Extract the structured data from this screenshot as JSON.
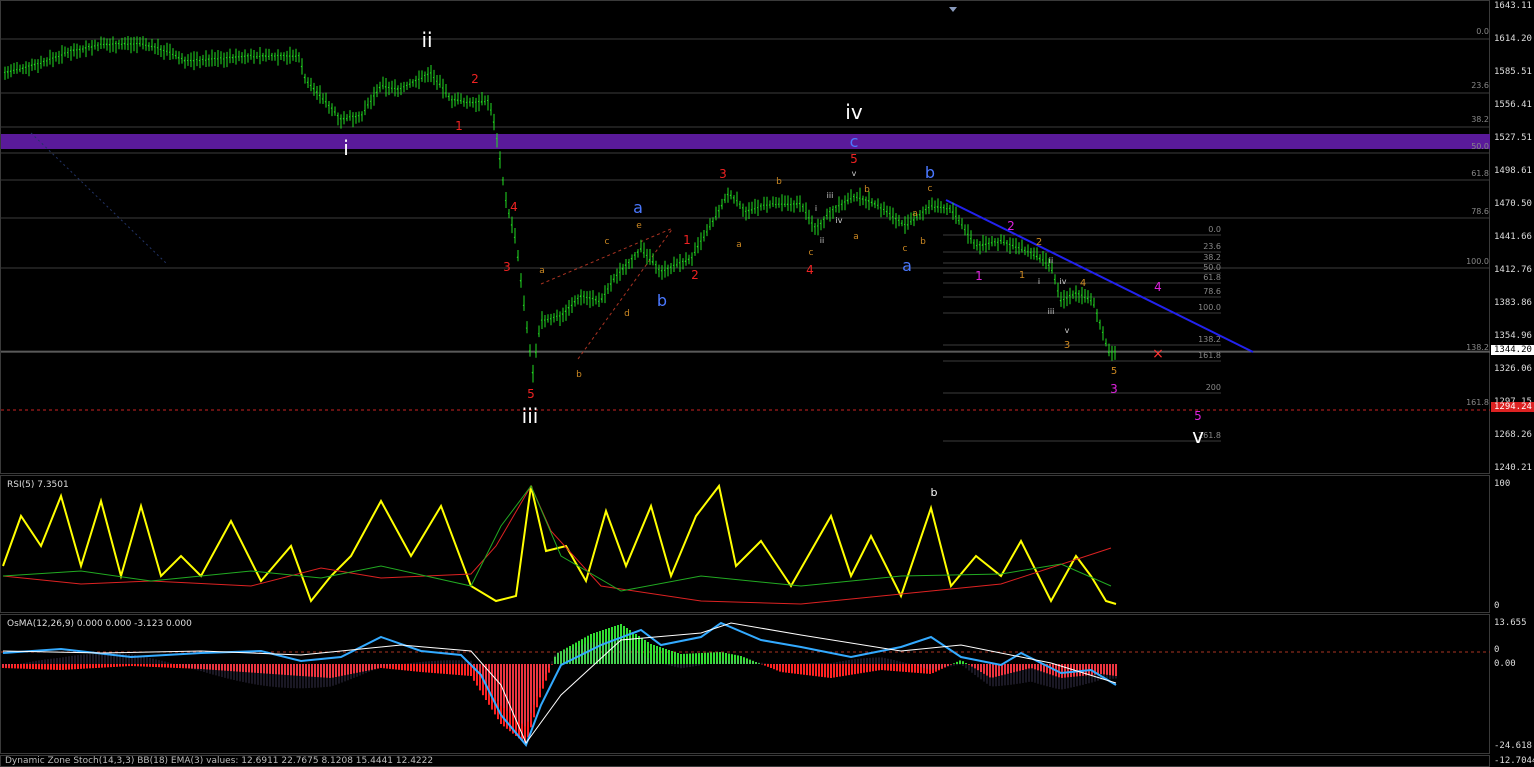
{
  "colors": {
    "background": "#000000",
    "candle": "#22dd22",
    "zone": "#5a1a9a",
    "grid": "#3c3c3c",
    "trendline": "#2222ee",
    "support": "#cc2222",
    "rsi": "#ffff00",
    "rsi_ma_green": "#22aa22",
    "rsi_ma_red": "#dd2222",
    "osma_green": "#33dd33",
    "osma_red": "#ff2222",
    "osma_line": "#33aaff"
  },
  "main_axis": {
    "ticks": [
      "1643.11",
      "1614.20",
      "1585.51",
      "1556.41",
      "1527.51",
      "1498.61",
      "1470.50",
      "1441.66",
      "1412.76",
      "1383.86",
      "1354.96",
      "1326.06",
      "1297.15",
      "1268.26",
      "1240.21"
    ]
  },
  "current_price": "1344.20",
  "support_price": "1294.24",
  "rsi": {
    "label": "RSI(5) 7.3501",
    "ticks": [
      "100",
      "0"
    ]
  },
  "osma": {
    "label": "OsMA(12,26,9) 0.000 0.000 -3.123 0.000",
    "ticks": [
      "13.655",
      "0",
      "0.00",
      "-24.618"
    ]
  },
  "stoch": {
    "label": "Dynamic Zone Stoch(14,3,3) BB(18) EMA(3) values: 12.6911 22.7675 8.1208 15.4441 12.4222",
    "tick": "-12.7044"
  },
  "wave_labels": {
    "ii": "ii",
    "i": "i",
    "iii": "iii",
    "iv": "iv",
    "v": "v",
    "c_top": "c",
    "b_top": "b",
    "a_blue1": "a",
    "b_blue1": "b",
    "a_blue2": "a",
    "b_rsi": "b",
    "r2": "2",
    "r1": "1",
    "r4": "4",
    "r3": "3",
    "r5_low": "5",
    "r1b": "1",
    "r2b": "2",
    "r3b": "3",
    "r4b": "4",
    "r5_top": "5",
    "m2": "2",
    "m1": "1",
    "m3": "3",
    "m4": "4",
    "m5": "5",
    "o_a": "a",
    "o_b": "b",
    "o_c": "c",
    "o_d": "d",
    "o_e": "e",
    "o_b2": "b",
    "o_a2": "a",
    "o_b3": "b",
    "o_c3": "c",
    "o_a3": "a",
    "o_b4": "b",
    "o_c4": "c",
    "w_i": "i",
    "w_ii": "ii",
    "w_iii": "iii",
    "w_iv": "iv",
    "w_v": "v",
    "w_v_top": "v",
    "w_iii_top": "iii",
    "w_iv_top": "iv",
    "w_ii_top": "ii",
    "or1": "1",
    "or2": "2",
    "or3": "3",
    "or4": "4",
    "or5": "5",
    "cross": "×"
  },
  "fib_right": [
    {
      "label": "0.0"
    },
    {
      "label": "23.6"
    },
    {
      "label": "38.2"
    },
    {
      "label": "50.0"
    },
    {
      "label": "61.8"
    },
    {
      "label": "78.6"
    },
    {
      "label": "100.0"
    },
    {
      "label": "138.2"
    },
    {
      "label": "161.8"
    },
    {
      "label": "61.8"
    }
  ],
  "fib_small": [
    {
      "label": "0.0"
    },
    {
      "label": "23.6"
    },
    {
      "label": "38.2"
    },
    {
      "label": "50.0"
    },
    {
      "label": "61.8"
    },
    {
      "label": "78.6"
    },
    {
      "label": "100.0"
    },
    {
      "label": "138.2"
    },
    {
      "label": "161.8"
    },
    {
      "label": "200"
    },
    {
      "label": "261.8"
    }
  ]
}
